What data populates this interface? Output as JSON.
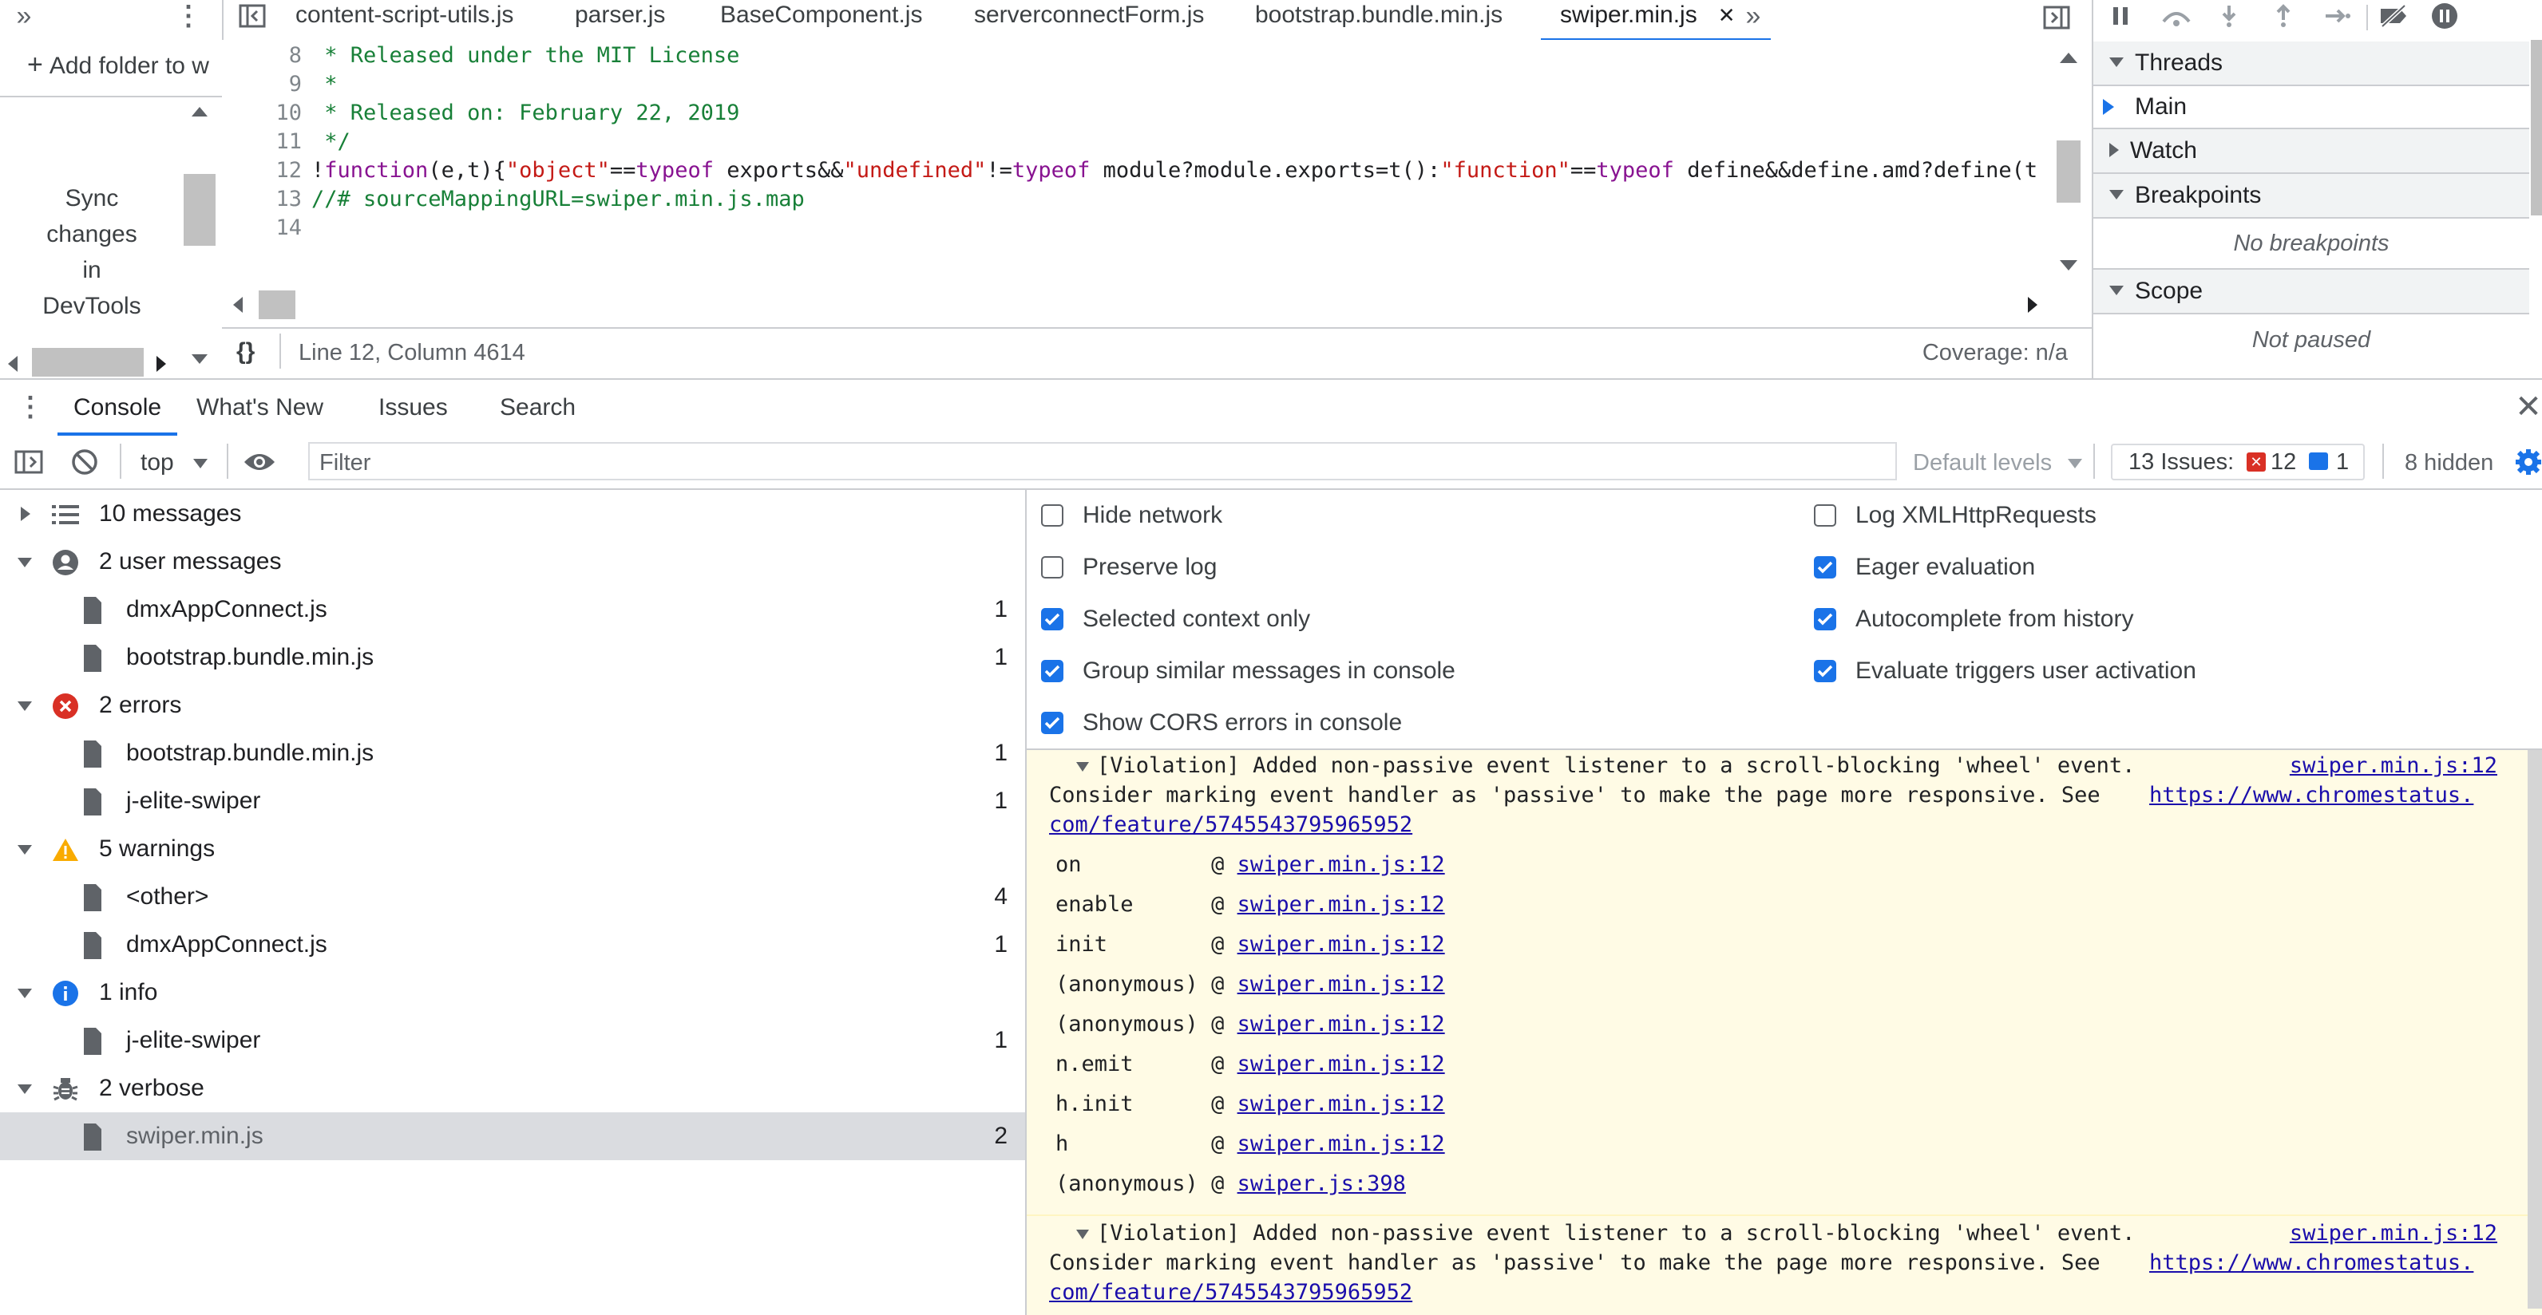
{
  "colors": {
    "accent": "#1a73e8",
    "error": "#d93025",
    "warning": "#f9ab00",
    "info": "#1a73e8",
    "warnbg": "#fffbe5"
  },
  "tabs": [
    {
      "label": "content-script-utils.js"
    },
    {
      "label": "parser.js"
    },
    {
      "label": "BaseComponent.js"
    },
    {
      "label": "serverconnectForm.js"
    },
    {
      "label": "bootstrap.bundle.min.js"
    },
    {
      "label": "swiper.min.js",
      "active": true
    }
  ],
  "navigator": {
    "add_folder": "Add folder to w",
    "sync_text": [
      "Sync",
      "changes",
      "in",
      "DevTools"
    ]
  },
  "editor": {
    "lines": [
      {
        "n": "8",
        "text": " * Released under the MIT License"
      },
      {
        "n": "9",
        "text": " *"
      },
      {
        "n": "10",
        "text": " * Released on: February 22, 2019"
      },
      {
        "n": "11",
        "text": " */"
      },
      {
        "n": "12",
        "text": "!function(e,t){\"object\"==typeof exports&&\"undefined\"!=typeof module?module.exports=t():\"function\"==typeof define&&define.amd?define(t"
      },
      {
        "n": "13",
        "text": "//# sourceMappingURL=swiper.min.js.map"
      },
      {
        "n": "14",
        "text": ""
      }
    ],
    "status": {
      "position": "Line 12, Column 4614",
      "coverage": "Coverage: n/a",
      "format_icon": "{}"
    }
  },
  "debugger": {
    "threads": "Threads",
    "main": "Main",
    "watch": "Watch",
    "breakpoints": "Breakpoints",
    "no_breakpoints": "No breakpoints",
    "scope": "Scope",
    "not_paused": "Not paused"
  },
  "drawer": {
    "tabs": [
      "Console",
      "What's New",
      "Issues",
      "Search"
    ]
  },
  "toolbar": {
    "context": "top",
    "filter_placeholder": "Filter",
    "levels": "Default levels",
    "issues_label": "13 Issues:",
    "issues_errors": "12",
    "issues_info": "1",
    "hidden": "8 hidden"
  },
  "sidebar": {
    "rows": [
      {
        "label": "10 messages",
        "icon": "list-icon",
        "level": 0,
        "expanded": false
      },
      {
        "label": "2 user messages",
        "icon": "user-icon",
        "level": 0,
        "expanded": true
      },
      {
        "label": "dmxAppConnect.js",
        "icon": "file-icon",
        "level": 1,
        "count": "1"
      },
      {
        "label": "bootstrap.bundle.min.js",
        "icon": "file-icon",
        "level": 1,
        "count": "1"
      },
      {
        "label": "2 errors",
        "icon": "error-icon",
        "level": 0,
        "expanded": true
      },
      {
        "label": "bootstrap.bundle.min.js",
        "icon": "file-icon",
        "level": 1,
        "count": "1"
      },
      {
        "label": "j-elite-swiper",
        "icon": "file-icon",
        "level": 1,
        "count": "1"
      },
      {
        "label": "5 warnings",
        "icon": "warning-icon",
        "level": 0,
        "expanded": true
      },
      {
        "label": "<other>",
        "icon": "file-icon",
        "level": 1,
        "count": "4"
      },
      {
        "label": "dmxAppConnect.js",
        "icon": "file-icon",
        "level": 1,
        "count": "1"
      },
      {
        "label": "1 info",
        "icon": "info-icon",
        "level": 0,
        "expanded": true
      },
      {
        "label": "j-elite-swiper",
        "icon": "file-icon",
        "level": 1,
        "count": "1"
      },
      {
        "label": "2 verbose",
        "icon": "bug-icon",
        "level": 0,
        "expanded": true
      },
      {
        "label": "swiper.min.js",
        "icon": "file-icon",
        "level": 1,
        "count": "2",
        "selected": true
      }
    ]
  },
  "settings": {
    "left": [
      {
        "label": "Hide network",
        "checked": false
      },
      {
        "label": "Preserve log",
        "checked": false
      },
      {
        "label": "Selected context only",
        "checked": true
      },
      {
        "label": "Group similar messages in console",
        "checked": true
      },
      {
        "label": "Show CORS errors in console",
        "checked": true
      }
    ],
    "right": [
      {
        "label": "Log XMLHttpRequests",
        "checked": false
      },
      {
        "label": "Eager evaluation",
        "checked": true
      },
      {
        "label": "Autocomplete from history",
        "checked": true
      },
      {
        "label": "Evaluate triggers user activation",
        "checked": true
      }
    ]
  },
  "messages": [
    {
      "line1": "[Violation] Added non-passive event listener to a scroll-blocking 'wheel' event.",
      "line2": "Consider marking event handler as 'passive' to make the page more responsive. See ",
      "link1": "https://www.chromestatus.",
      "link2": "com/feature/5745543795965952",
      "source": "swiper.min.js:12",
      "stack": [
        {
          "fn": "on          ",
          "at": "@ ",
          "src": "swiper.min.js:12"
        },
        {
          "fn": "enable      ",
          "at": "@ ",
          "src": "swiper.min.js:12"
        },
        {
          "fn": "init        ",
          "at": "@ ",
          "src": "swiper.min.js:12"
        },
        {
          "fn": "(anonymous) ",
          "at": "@ ",
          "src": "swiper.min.js:12"
        },
        {
          "fn": "(anonymous) ",
          "at": "@ ",
          "src": "swiper.min.js:12"
        },
        {
          "fn": "n.emit      ",
          "at": "@ ",
          "src": "swiper.min.js:12"
        },
        {
          "fn": "h.init      ",
          "at": "@ ",
          "src": "swiper.min.js:12"
        },
        {
          "fn": "h           ",
          "at": "@ ",
          "src": "swiper.min.js:12"
        },
        {
          "fn": "(anonymous) ",
          "at": "@ ",
          "src": "swiper.js:398"
        }
      ]
    },
    {
      "line1": "[Violation] Added non-passive event listener to a scroll-blocking 'wheel' event.",
      "line2": "Consider marking event handler as 'passive' to make the page more responsive. See ",
      "link1": "https://www.chromestatus.",
      "link2": "com/feature/5745543795965952",
      "source": "swiper.min.js:12"
    }
  ]
}
